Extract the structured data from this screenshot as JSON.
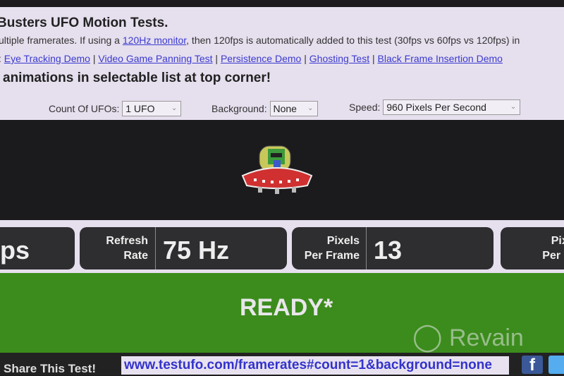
{
  "header": {
    "title": "Busters UFO Motion Tests.",
    "desc_pre": "ultiple framerates. If using a ",
    "desc_link": "120Hz monitor",
    "desc_post": ", then 120fps is automatically added to this test (30fps vs 60fps vs 120fps) in",
    "links_prefix": ": ",
    "links": [
      "Eye Tracking Demo",
      "Video Game Panning Test",
      "Persistence Demo",
      "Ghosting Test",
      "Black Frame Insertion Demo"
    ],
    "separator": " | ",
    "notice": "animations in selectable list at top corner!"
  },
  "controls": {
    "count_label": "Count Of UFOs:",
    "count_value": "1 UFO",
    "background_label": "Background:",
    "background_value": "None",
    "speed_label": "Speed:",
    "speed_value": "960 Pixels Per Second"
  },
  "stats": {
    "fps_partial": "ps",
    "refresh_label_1": "Refresh",
    "refresh_label_2": "Rate",
    "refresh_value": "75 Hz",
    "ppf_label_1": "Pixels",
    "ppf_label_2": "Per Frame",
    "ppf_value": "13",
    "pps_label_1": "Pixels",
    "pps_label_2": "Per Sec"
  },
  "status": "READY*",
  "watermark": "Revain",
  "footer": {
    "share_label": "Share This Test!",
    "share_url": "www.testufo.com/framerates#count=1&background=none",
    "facebook_icon": "f"
  },
  "colors": {
    "page": "#e6dfee",
    "stat_box": "#2e2d30",
    "ready": "#3b8c1c",
    "link": "#3a3ad0"
  }
}
